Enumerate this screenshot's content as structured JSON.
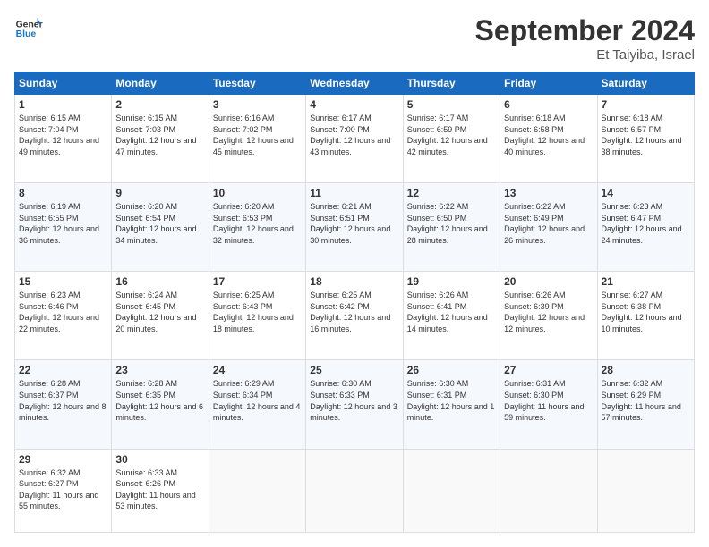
{
  "header": {
    "logo_text_general": "General",
    "logo_text_blue": "Blue",
    "month_title": "September 2024",
    "location": "Et Taiyiba, Israel"
  },
  "calendar": {
    "headers": [
      "Sunday",
      "Monday",
      "Tuesday",
      "Wednesday",
      "Thursday",
      "Friday",
      "Saturday"
    ],
    "weeks": [
      [
        null,
        {
          "day": 2,
          "sunrise": "6:15 AM",
          "sunset": "7:03 PM",
          "daylight": "12 hours and 47 minutes."
        },
        {
          "day": 3,
          "sunrise": "6:16 AM",
          "sunset": "7:02 PM",
          "daylight": "12 hours and 45 minutes."
        },
        {
          "day": 4,
          "sunrise": "6:17 AM",
          "sunset": "7:00 PM",
          "daylight": "12 hours and 43 minutes."
        },
        {
          "day": 5,
          "sunrise": "6:17 AM",
          "sunset": "6:59 PM",
          "daylight": "12 hours and 42 minutes."
        },
        {
          "day": 6,
          "sunrise": "6:18 AM",
          "sunset": "6:58 PM",
          "daylight": "12 hours and 40 minutes."
        },
        {
          "day": 7,
          "sunrise": "6:18 AM",
          "sunset": "6:57 PM",
          "daylight": "12 hours and 38 minutes."
        }
      ],
      [
        {
          "day": 1,
          "sunrise": "6:15 AM",
          "sunset": "7:04 PM",
          "daylight": "12 hours and 49 minutes."
        },
        {
          "day": 9,
          "sunrise": "6:20 AM",
          "sunset": "6:54 PM",
          "daylight": "12 hours and 34 minutes."
        },
        {
          "day": 10,
          "sunrise": "6:20 AM",
          "sunset": "6:53 PM",
          "daylight": "12 hours and 32 minutes."
        },
        {
          "day": 11,
          "sunrise": "6:21 AM",
          "sunset": "6:51 PM",
          "daylight": "12 hours and 30 minutes."
        },
        {
          "day": 12,
          "sunrise": "6:22 AM",
          "sunset": "6:50 PM",
          "daylight": "12 hours and 28 minutes."
        },
        {
          "day": 13,
          "sunrise": "6:22 AM",
          "sunset": "6:49 PM",
          "daylight": "12 hours and 26 minutes."
        },
        {
          "day": 14,
          "sunrise": "6:23 AM",
          "sunset": "6:47 PM",
          "daylight": "12 hours and 24 minutes."
        }
      ],
      [
        {
          "day": 8,
          "sunrise": "6:19 AM",
          "sunset": "6:55 PM",
          "daylight": "12 hours and 36 minutes."
        },
        {
          "day": 16,
          "sunrise": "6:24 AM",
          "sunset": "6:45 PM",
          "daylight": "12 hours and 20 minutes."
        },
        {
          "day": 17,
          "sunrise": "6:25 AM",
          "sunset": "6:43 PM",
          "daylight": "12 hours and 18 minutes."
        },
        {
          "day": 18,
          "sunrise": "6:25 AM",
          "sunset": "6:42 PM",
          "daylight": "12 hours and 16 minutes."
        },
        {
          "day": 19,
          "sunrise": "6:26 AM",
          "sunset": "6:41 PM",
          "daylight": "12 hours and 14 minutes."
        },
        {
          "day": 20,
          "sunrise": "6:26 AM",
          "sunset": "6:39 PM",
          "daylight": "12 hours and 12 minutes."
        },
        {
          "day": 21,
          "sunrise": "6:27 AM",
          "sunset": "6:38 PM",
          "daylight": "12 hours and 10 minutes."
        }
      ],
      [
        {
          "day": 15,
          "sunrise": "6:23 AM",
          "sunset": "6:46 PM",
          "daylight": "12 hours and 22 minutes."
        },
        {
          "day": 23,
          "sunrise": "6:28 AM",
          "sunset": "6:35 PM",
          "daylight": "12 hours and 6 minutes."
        },
        {
          "day": 24,
          "sunrise": "6:29 AM",
          "sunset": "6:34 PM",
          "daylight": "12 hours and 4 minutes."
        },
        {
          "day": 25,
          "sunrise": "6:30 AM",
          "sunset": "6:33 PM",
          "daylight": "12 hours and 3 minutes."
        },
        {
          "day": 26,
          "sunrise": "6:30 AM",
          "sunset": "6:31 PM",
          "daylight": "12 hours and 1 minute."
        },
        {
          "day": 27,
          "sunrise": "6:31 AM",
          "sunset": "6:30 PM",
          "daylight": "11 hours and 59 minutes."
        },
        {
          "day": 28,
          "sunrise": "6:32 AM",
          "sunset": "6:29 PM",
          "daylight": "11 hours and 57 minutes."
        }
      ],
      [
        {
          "day": 22,
          "sunrise": "6:28 AM",
          "sunset": "6:37 PM",
          "daylight": "12 hours and 8 minutes."
        },
        {
          "day": 30,
          "sunrise": "6:33 AM",
          "sunset": "6:26 PM",
          "daylight": "11 hours and 53 minutes."
        },
        null,
        null,
        null,
        null,
        null
      ],
      [
        {
          "day": 29,
          "sunrise": "6:32 AM",
          "sunset": "6:27 PM",
          "daylight": "11 hours and 55 minutes."
        },
        null,
        null,
        null,
        null,
        null,
        null
      ]
    ]
  }
}
